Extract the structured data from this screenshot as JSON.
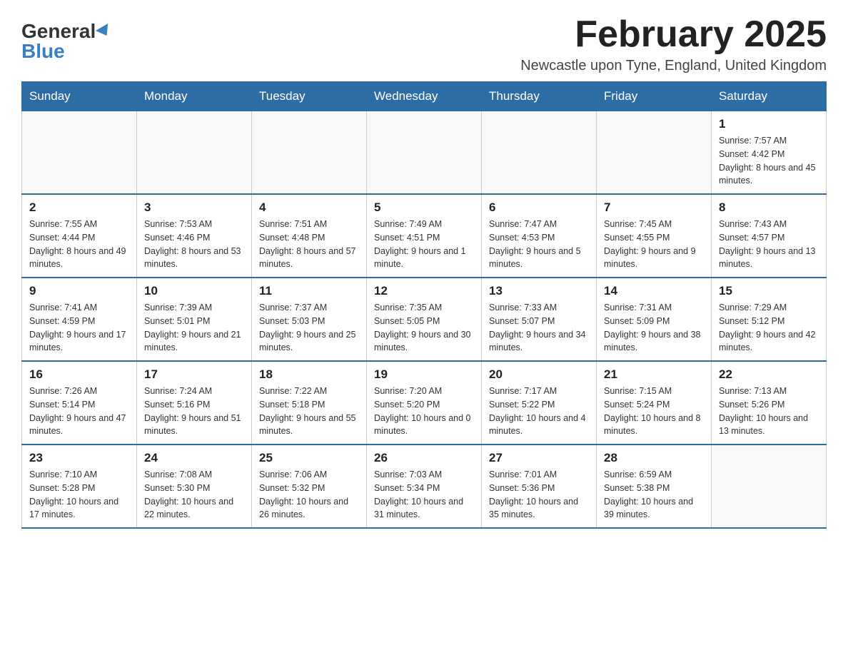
{
  "logo": {
    "general": "General",
    "blue": "Blue"
  },
  "title": "February 2025",
  "location": "Newcastle upon Tyne, England, United Kingdom",
  "weekdays": [
    "Sunday",
    "Monday",
    "Tuesday",
    "Wednesday",
    "Thursday",
    "Friday",
    "Saturday"
  ],
  "weeks": [
    [
      {
        "day": "",
        "info": ""
      },
      {
        "day": "",
        "info": ""
      },
      {
        "day": "",
        "info": ""
      },
      {
        "day": "",
        "info": ""
      },
      {
        "day": "",
        "info": ""
      },
      {
        "day": "",
        "info": ""
      },
      {
        "day": "1",
        "info": "Sunrise: 7:57 AM\nSunset: 4:42 PM\nDaylight: 8 hours and 45 minutes."
      }
    ],
    [
      {
        "day": "2",
        "info": "Sunrise: 7:55 AM\nSunset: 4:44 PM\nDaylight: 8 hours and 49 minutes."
      },
      {
        "day": "3",
        "info": "Sunrise: 7:53 AM\nSunset: 4:46 PM\nDaylight: 8 hours and 53 minutes."
      },
      {
        "day": "4",
        "info": "Sunrise: 7:51 AM\nSunset: 4:48 PM\nDaylight: 8 hours and 57 minutes."
      },
      {
        "day": "5",
        "info": "Sunrise: 7:49 AM\nSunset: 4:51 PM\nDaylight: 9 hours and 1 minute."
      },
      {
        "day": "6",
        "info": "Sunrise: 7:47 AM\nSunset: 4:53 PM\nDaylight: 9 hours and 5 minutes."
      },
      {
        "day": "7",
        "info": "Sunrise: 7:45 AM\nSunset: 4:55 PM\nDaylight: 9 hours and 9 minutes."
      },
      {
        "day": "8",
        "info": "Sunrise: 7:43 AM\nSunset: 4:57 PM\nDaylight: 9 hours and 13 minutes."
      }
    ],
    [
      {
        "day": "9",
        "info": "Sunrise: 7:41 AM\nSunset: 4:59 PM\nDaylight: 9 hours and 17 minutes."
      },
      {
        "day": "10",
        "info": "Sunrise: 7:39 AM\nSunset: 5:01 PM\nDaylight: 9 hours and 21 minutes."
      },
      {
        "day": "11",
        "info": "Sunrise: 7:37 AM\nSunset: 5:03 PM\nDaylight: 9 hours and 25 minutes."
      },
      {
        "day": "12",
        "info": "Sunrise: 7:35 AM\nSunset: 5:05 PM\nDaylight: 9 hours and 30 minutes."
      },
      {
        "day": "13",
        "info": "Sunrise: 7:33 AM\nSunset: 5:07 PM\nDaylight: 9 hours and 34 minutes."
      },
      {
        "day": "14",
        "info": "Sunrise: 7:31 AM\nSunset: 5:09 PM\nDaylight: 9 hours and 38 minutes."
      },
      {
        "day": "15",
        "info": "Sunrise: 7:29 AM\nSunset: 5:12 PM\nDaylight: 9 hours and 42 minutes."
      }
    ],
    [
      {
        "day": "16",
        "info": "Sunrise: 7:26 AM\nSunset: 5:14 PM\nDaylight: 9 hours and 47 minutes."
      },
      {
        "day": "17",
        "info": "Sunrise: 7:24 AM\nSunset: 5:16 PM\nDaylight: 9 hours and 51 minutes."
      },
      {
        "day": "18",
        "info": "Sunrise: 7:22 AM\nSunset: 5:18 PM\nDaylight: 9 hours and 55 minutes."
      },
      {
        "day": "19",
        "info": "Sunrise: 7:20 AM\nSunset: 5:20 PM\nDaylight: 10 hours and 0 minutes."
      },
      {
        "day": "20",
        "info": "Sunrise: 7:17 AM\nSunset: 5:22 PM\nDaylight: 10 hours and 4 minutes."
      },
      {
        "day": "21",
        "info": "Sunrise: 7:15 AM\nSunset: 5:24 PM\nDaylight: 10 hours and 8 minutes."
      },
      {
        "day": "22",
        "info": "Sunrise: 7:13 AM\nSunset: 5:26 PM\nDaylight: 10 hours and 13 minutes."
      }
    ],
    [
      {
        "day": "23",
        "info": "Sunrise: 7:10 AM\nSunset: 5:28 PM\nDaylight: 10 hours and 17 minutes."
      },
      {
        "day": "24",
        "info": "Sunrise: 7:08 AM\nSunset: 5:30 PM\nDaylight: 10 hours and 22 minutes."
      },
      {
        "day": "25",
        "info": "Sunrise: 7:06 AM\nSunset: 5:32 PM\nDaylight: 10 hours and 26 minutes."
      },
      {
        "day": "26",
        "info": "Sunrise: 7:03 AM\nSunset: 5:34 PM\nDaylight: 10 hours and 31 minutes."
      },
      {
        "day": "27",
        "info": "Sunrise: 7:01 AM\nSunset: 5:36 PM\nDaylight: 10 hours and 35 minutes."
      },
      {
        "day": "28",
        "info": "Sunrise: 6:59 AM\nSunset: 5:38 PM\nDaylight: 10 hours and 39 minutes."
      },
      {
        "day": "",
        "info": ""
      }
    ]
  ]
}
